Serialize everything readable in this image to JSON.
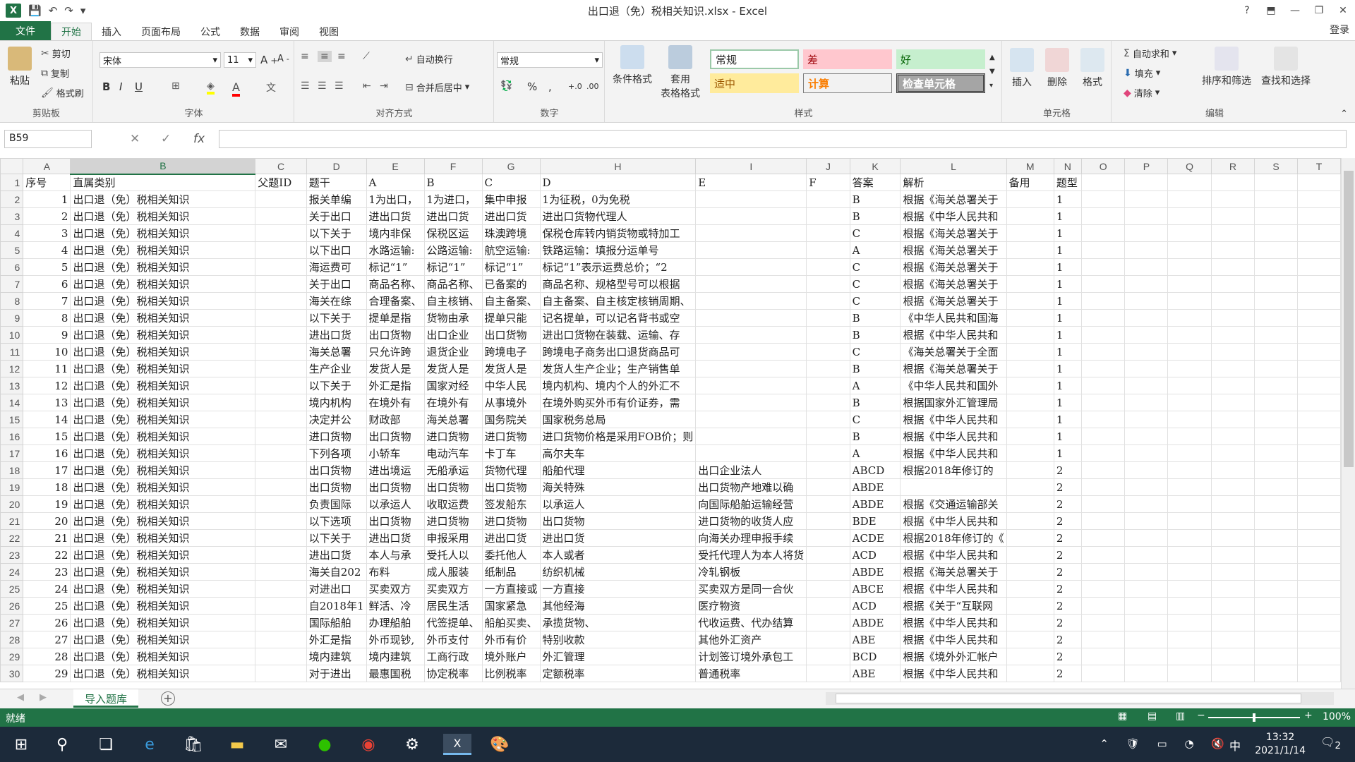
{
  "window": {
    "title": "出口退（免）税相关知识.xlsx - Excel",
    "help": "?",
    "login": "登录"
  },
  "tabs": [
    "文件",
    "开始",
    "插入",
    "页面布局",
    "公式",
    "数据",
    "审阅",
    "视图"
  ],
  "ribbon": {
    "clipboard": {
      "paste": "粘贴",
      "cut": "剪切",
      "copy": "复制",
      "format_painter": "格式刷",
      "label": "剪贴板"
    },
    "font": {
      "name": "宋体",
      "size": "11",
      "label": "字体"
    },
    "alignment": {
      "wrap": "自动换行",
      "merge": "合并后居中",
      "label": "对齐方式"
    },
    "number": {
      "format": "常规",
      "label": "数字"
    },
    "styles": {
      "conditional": "条件格式",
      "table": "套用\n表格格式",
      "normal": "常规",
      "bad": "差",
      "good": "好",
      "neutral": "适中",
      "calc": "计算",
      "check": "检查单元格",
      "label": "样式"
    },
    "cells": {
      "insert": "插入",
      "delete": "删除",
      "format": "格式",
      "label": "单元格"
    },
    "editing": {
      "autosum": "自动求和",
      "fill": "填充",
      "clear": "清除",
      "sort": "排序和筛选",
      "find": "查找和选择",
      "label": "编辑"
    }
  },
  "formula": {
    "namebox": "B59",
    "fx": "fx",
    "value": ""
  },
  "columns": [
    "A",
    "B",
    "C",
    "D",
    "E",
    "F",
    "G",
    "H",
    "I",
    "J",
    "K",
    "L",
    "M",
    "N",
    "O",
    "P",
    "Q",
    "R",
    "S",
    "T"
  ],
  "header_row": [
    "序号",
    "直属类别",
    "父题ID",
    "题干",
    "A",
    "B",
    "C",
    "D",
    "E",
    "F",
    "答案",
    "解析",
    "备用",
    "题型"
  ],
  "rows": [
    [
      "1",
      "出口退（免）税相关知识",
      "",
      "报关单编",
      "1为出口，",
      "1为进口，",
      "集中申报",
      "1为征税，0为免税",
      "",
      "",
      "B",
      "根据《海关总署关于",
      "",
      "1"
    ],
    [
      "2",
      "出口退（免）税相关知识",
      "",
      "关于出口",
      "进出口货",
      "进出口货",
      "进出口货",
      "进出口货物代理人",
      "",
      "",
      "B",
      "根据《中华人民共和",
      "",
      "1"
    ],
    [
      "3",
      "出口退（免）税相关知识",
      "",
      "以下关于",
      "境内非保",
      "保税区运",
      "珠澳跨境",
      "保税仓库转内销货物或特加工",
      "",
      "",
      "C",
      "根据《海关总署关于",
      "",
      "1"
    ],
    [
      "4",
      "出口退（免）税相关知识",
      "",
      "以下出口",
      "水路运输:",
      "公路运输:",
      "航空运输:",
      "铁路运输：填报分运单号",
      "",
      "",
      "A",
      "根据《海关总署关于",
      "",
      "1"
    ],
    [
      "5",
      "出口退（免）税相关知识",
      "",
      "海运费可",
      "标记“1”",
      "标记“1”",
      "标记“1”",
      "标记“1”表示运费总价；“2",
      "",
      "",
      "C",
      "根据《海关总署关于",
      "",
      "1"
    ],
    [
      "6",
      "出口退（免）税相关知识",
      "",
      "关于出口",
      "商品名称、",
      "商品名称、",
      "已备案的",
      "商品名称、规格型号可以根据",
      "",
      "",
      "C",
      "根据《海关总署关于",
      "",
      "1"
    ],
    [
      "7",
      "出口退（免）税相关知识",
      "",
      "海关在综",
      "合理备案、",
      "自主核销、",
      "自主备案、",
      "自主备案、自主核定核销周期、",
      "",
      "",
      "C",
      "根据《海关总署关于",
      "",
      "1"
    ],
    [
      "8",
      "出口退（免）税相关知识",
      "",
      "以下关于",
      "提单是指",
      "货物由承",
      "提单只能",
      "记名提单，可以记名背书或空",
      "",
      "",
      "B",
      "《中华人民共和国海",
      "",
      "1"
    ],
    [
      "9",
      "出口退（免）税相关知识",
      "",
      "进出口货",
      "出口货物",
      "出口企业",
      "出口货物",
      "进出口货物在装载、运输、存",
      "",
      "",
      "B",
      "根据《中华人民共和",
      "",
      "1"
    ],
    [
      "10",
      "出口退（免）税相关知识",
      "",
      "海关总署",
      "只允许跨",
      "退货企业",
      "跨境电子",
      "跨境电子商务出口退货商品可",
      "",
      "",
      "C",
      "《海关总署关于全面",
      "",
      "1"
    ],
    [
      "11",
      "出口退（免）税相关知识",
      "",
      "生产企业",
      "发货人是",
      "发货人是",
      "发货人是",
      "发货人生产企业；生产销售单",
      "",
      "",
      "B",
      "根据《海关总署关于",
      "",
      "1"
    ],
    [
      "12",
      "出口退（免）税相关知识",
      "",
      "以下关于",
      "外汇是指",
      "国家对经",
      "中华人民",
      "境内机构、境内个人的外汇不",
      "",
      "",
      "A",
      "《中华人民共和国外",
      "",
      "1"
    ],
    [
      "13",
      "出口退（免）税相关知识",
      "",
      "境内机构",
      "在境外有",
      "在境外有",
      "从事境外",
      "在境外购买外币有价证券，需",
      "",
      "",
      "B",
      "根据国家外汇管理局",
      "",
      "1"
    ],
    [
      "14",
      "出口退（免）税相关知识",
      "",
      "决定并公",
      "财政部",
      "海关总署",
      "国务院关",
      "国家税务总局",
      "",
      "",
      "C",
      "根据《中华人民共和",
      "",
      "1"
    ],
    [
      "15",
      "出口退（免）税相关知识",
      "",
      "进口货物",
      "出口货物",
      "进口货物",
      "进口货物",
      "进口货物价格是采用FOB价；则",
      "",
      "",
      "B",
      "根据《中华人民共和",
      "",
      "1"
    ],
    [
      "16",
      "出口退（免）税相关知识",
      "",
      "下列各项",
      "小轿车",
      "电动汽车",
      "卡丁车",
      "高尔夫车",
      "",
      "",
      "A",
      "根据《中华人民共和",
      "",
      "1"
    ],
    [
      "17",
      "出口退（免）税相关知识",
      "",
      "出口货物",
      "进出境运",
      "无船承运",
      "货物代理",
      "船舶代理",
      "出口企业法人",
      "",
      "ABCD",
      "根据2018年修订的",
      "",
      "2"
    ],
    [
      "18",
      "出口退（免）税相关知识",
      "",
      "出口货物",
      "出口货物",
      "出口货物",
      "出口货物",
      "海关特殊",
      "出口货物产地难以确",
      "",
      "ABDE",
      "",
      "",
      "2"
    ],
    [
      "19",
      "出口退（免）税相关知识",
      "",
      "负责国际",
      "以承运人",
      "收取运费",
      "签发船东",
      "以承运人",
      "向国际船舶运输经营",
      "",
      "ABDE",
      "根据《交通运输部关",
      "",
      "2"
    ],
    [
      "20",
      "出口退（免）税相关知识",
      "",
      "以下选项",
      "出口货物",
      "进口货物",
      "进口货物",
      "出口货物",
      "进口货物的收货人应",
      "",
      "BDE",
      "根据《中华人民共和",
      "",
      "2"
    ],
    [
      "21",
      "出口退（免）税相关知识",
      "",
      "以下关于",
      "进出口货",
      "申报采用",
      "进出口货",
      "进出口货",
      "向海关办理申报手续",
      "",
      "ACDE",
      "根据2018年修订的《",
      "",
      "2"
    ],
    [
      "22",
      "出口退（免）税相关知识",
      "",
      "进出口货",
      "本人与承",
      "受托人以",
      "委托他人",
      "本人或者",
      "受托代理人为本人将货",
      "",
      "ACD",
      "根据《中华人民共和",
      "",
      "2"
    ],
    [
      "23",
      "出口退（免）税相关知识",
      "",
      "海关自202",
      "布料",
      "成人服装",
      "纸制品",
      "纺织机械",
      "冷轧钢板",
      "",
      "ABDE",
      "根据《海关总署关于",
      "",
      "2"
    ],
    [
      "24",
      "出口退（免）税相关知识",
      "",
      "对进出口",
      "买卖双方",
      "买卖双方",
      "一方直接或",
      "一方直接",
      "买卖双方是同一合伙",
      "",
      "ABCE",
      "根据《中华人民共和",
      "",
      "2"
    ],
    [
      "25",
      "出口退（免）税相关知识",
      "",
      "自2018年1",
      "鲜活、冷",
      "居民生活",
      "国家紧急",
      "其他经海",
      "医疗物资",
      "",
      "ACD",
      "根据《关于“互联网",
      "",
      "2"
    ],
    [
      "26",
      "出口退（免）税相关知识",
      "",
      "国际船舶",
      "办理船舶",
      "代签提单、",
      "船舶买卖、",
      "承揽货物、",
      "代收运费、代办结算",
      "",
      "ABDE",
      "根据《中华人民共和",
      "",
      "2"
    ],
    [
      "27",
      "出口退（免）税相关知识",
      "",
      "外汇是指",
      "外币现钞,",
      "外币支付",
      "外币有价",
      "特别收款",
      "其他外汇资产",
      "",
      "ABE",
      "根据《中华人民共和",
      "",
      "2"
    ],
    [
      "28",
      "出口退（免）税相关知识",
      "",
      "境内建筑",
      "境内建筑",
      "工商行政",
      "境外账户",
      "外汇管理",
      "计划签订境外承包工",
      "",
      "BCD",
      "根据《境外外汇帐户",
      "",
      "2"
    ],
    [
      "29",
      "出口退（免）税相关知识",
      "",
      "对于进出",
      "最惠国税",
      "协定税率",
      "比例税率",
      "定额税率",
      "普通税率",
      "",
      "ABE",
      "根据《中华人民共和",
      "",
      "2"
    ]
  ],
  "sheet": {
    "name": "导入题库",
    "add": "+"
  },
  "status": {
    "ready": "就绪",
    "zoom": "100%"
  },
  "taskbar": {
    "time": "13:32",
    "date": "2021/1/14",
    "ime": "中",
    "notif": "2"
  }
}
